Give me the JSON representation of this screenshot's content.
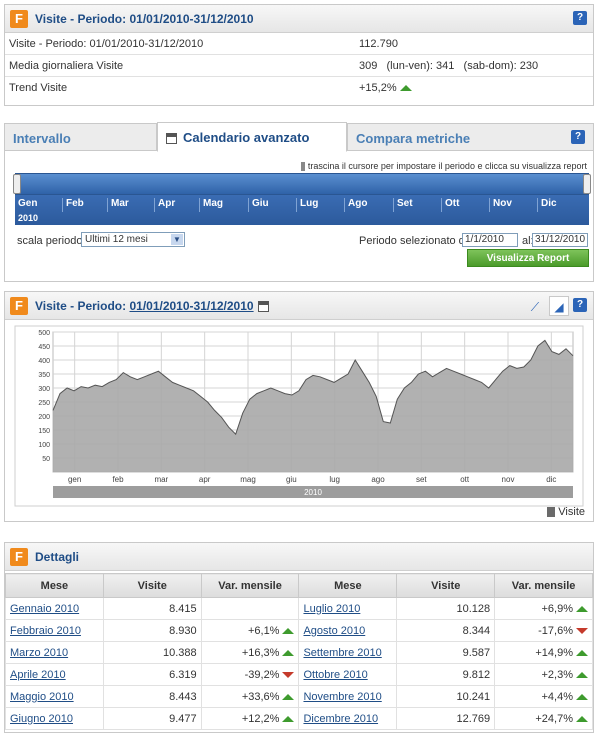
{
  "summary": {
    "title": "Visite - Periodo: 01/01/2010-31/12/2010",
    "rows": [
      {
        "label": "Visite - Periodo: 01/01/2010-31/12/2010",
        "value": "112.790"
      },
      {
        "label": "Media giornaliera Visite",
        "value": "309   (lun-ven): 341   (sab-dom): 230"
      },
      {
        "label": "Trend Visite",
        "value": "+15,2%"
      }
    ]
  },
  "tabs": {
    "items": [
      "Intervallo",
      "Calendario avanzato",
      "Compara metriche"
    ],
    "active": 1,
    "hint": "trascina il cursore per impostare il periodo e clicca su visualizza report",
    "months": [
      "Gen",
      "Feb",
      "Mar",
      "Apr",
      "Mag",
      "Giu",
      "Lug",
      "Ago",
      "Set",
      "Ott",
      "Nov",
      "Dic"
    ],
    "year": "2010",
    "scale_label": "scala periodo:",
    "scale_value": "Ultimi 12 mesi",
    "period_label": "Periodo selezionato dal:",
    "date_from": "1/1/2010",
    "al_label": "al:",
    "date_to": "31/12/2010",
    "report_button": "Visualizza Report"
  },
  "chart_panel": {
    "title_prefix": "Visite - Periodo: ",
    "title_period": "01/01/2010-31/12/2010",
    "legend": "Visite"
  },
  "chart_data": {
    "type": "area",
    "series": [
      {
        "name": "Visite",
        "values": [
          220,
          280,
          300,
          290,
          305,
          300,
          310,
          305,
          320,
          330,
          355,
          340,
          330,
          340,
          350,
          360,
          340,
          320,
          310,
          300,
          290,
          270,
          250,
          220,
          195,
          160,
          135,
          210,
          260,
          280,
          290,
          300,
          290,
          280,
          275,
          290,
          330,
          345,
          340,
          330,
          320,
          335,
          350,
          400,
          360,
          320,
          270,
          180,
          175,
          260,
          300,
          320,
          350,
          360,
          340,
          355,
          370,
          360,
          350,
          340,
          330,
          320,
          300,
          330,
          360,
          380,
          370,
          375,
          400,
          450,
          470,
          430,
          420,
          440,
          415
        ]
      }
    ],
    "x_tick_labels": [
      "gen",
      "feb",
      "mar",
      "apr",
      "mag",
      "giu",
      "lug",
      "ago",
      "set",
      "ott",
      "nov",
      "dic"
    ],
    "year_label": "2010",
    "ylim": [
      0,
      500
    ],
    "yticks": [
      50,
      100,
      150,
      200,
      250,
      300,
      350,
      400,
      450,
      500
    ],
    "colors": {
      "fill": "#a9a9a9",
      "stroke": "#555555",
      "grid": "#d4d4d4"
    }
  },
  "details": {
    "title": "Dettagli",
    "headers": [
      "Mese",
      "Visite",
      "Var. mensile"
    ],
    "left": [
      {
        "mese": "Gennaio 2010",
        "visite": "8.415",
        "var": "",
        "dir": ""
      },
      {
        "mese": "Febbraio 2010",
        "visite": "8.930",
        "var": "+6,1%",
        "dir": "up"
      },
      {
        "mese": "Marzo 2010",
        "visite": "10.388",
        "var": "+16,3%",
        "dir": "up"
      },
      {
        "mese": "Aprile 2010",
        "visite": "6.319",
        "var": "-39,2%",
        "dir": "down"
      },
      {
        "mese": "Maggio 2010",
        "visite": "8.443",
        "var": "+33,6%",
        "dir": "up"
      },
      {
        "mese": "Giugno 2010",
        "visite": "9.477",
        "var": "+12,2%",
        "dir": "up"
      }
    ],
    "right": [
      {
        "mese": "Luglio 2010",
        "visite": "10.128",
        "var": "+6,9%",
        "dir": "up"
      },
      {
        "mese": "Agosto 2010",
        "visite": "8.344",
        "var": "-17,6%",
        "dir": "down"
      },
      {
        "mese": "Settembre 2010",
        "visite": "9.587",
        "var": "+14,9%",
        "dir": "up"
      },
      {
        "mese": "Ottobre 2010",
        "visite": "9.812",
        "var": "+2,3%",
        "dir": "up"
      },
      {
        "mese": "Novembre 2010",
        "visite": "10.241",
        "var": "+4,4%",
        "dir": "up"
      },
      {
        "mese": "Dicembre 2010",
        "visite": "12.769",
        "var": "+24,7%",
        "dir": "up"
      }
    ]
  }
}
